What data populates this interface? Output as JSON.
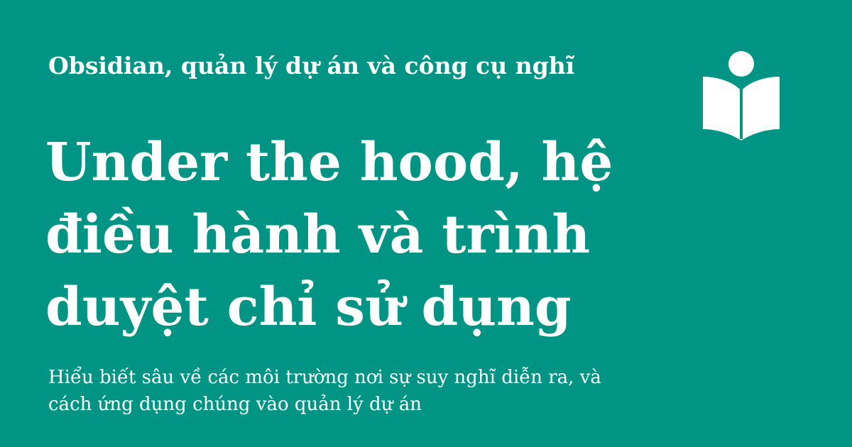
{
  "kicker": "Obsidian, quản lý dự án và công cụ nghĩ",
  "title": "Under the hood, hệ điều hành và trình duyệt chỉ sử dụng",
  "subtitle_line1": "Hiểu biết sâu về các môi trường nơi sự suy nghĩ diễn ra, và",
  "subtitle_line2": "cách ứng dụng chúng vào quản lý dự án",
  "colors": {
    "background": "#009485",
    "foreground": "#ffffff"
  },
  "logo_icon": "reader-book-icon"
}
